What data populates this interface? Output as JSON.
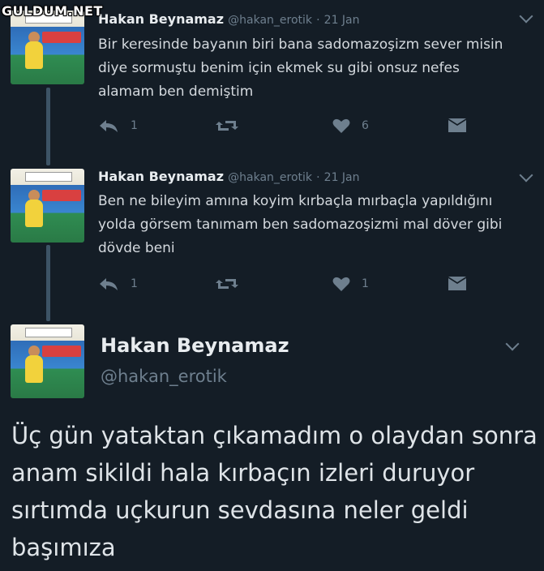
{
  "watermark": "GULDUM.NET",
  "thread": [
    {
      "name": "Hakan Beynamaz",
      "handle": "@hakan_erotik",
      "separator": "·",
      "time": "21 Jan",
      "text": "Bir keresinde bayanın biri bana sadomazoşizm sever misin diye sormuştu benim için ekmek su gibi onsuz nefes alamam ben demiştim",
      "reply_count": "1",
      "like_count": "6"
    },
    {
      "name": "Hakan Beynamaz",
      "handle": "@hakan_erotik",
      "separator": "·",
      "time": "21 Jan",
      "text": "Ben ne bileyim amına koyim kırbaçla mırbaçla yapıldığını yolda görsem tanımam ben sadomazoşizmi mal döver gibi dövde beni",
      "reply_count": "1",
      "like_count": "1"
    }
  ],
  "main_tweet": {
    "name": "Hakan Beynamaz",
    "handle": "@hakan_erotik",
    "text": "Üç gün yataktan çıkamadım o olaydan sonra anam sikildi hala kırbaçın izleri duruyor sırtımda uçkurun sevdasına neler geldi başımıza"
  },
  "icons": {
    "reply": "reply-icon",
    "retweet": "retweet-icon",
    "like": "heart-icon",
    "dm": "envelope-icon",
    "menu": "chevron-down-icon"
  },
  "colors": {
    "background": "#141d26",
    "muted": "#6e7f8e",
    "text": "#d4d9de",
    "thread_line": "#3d5466"
  }
}
